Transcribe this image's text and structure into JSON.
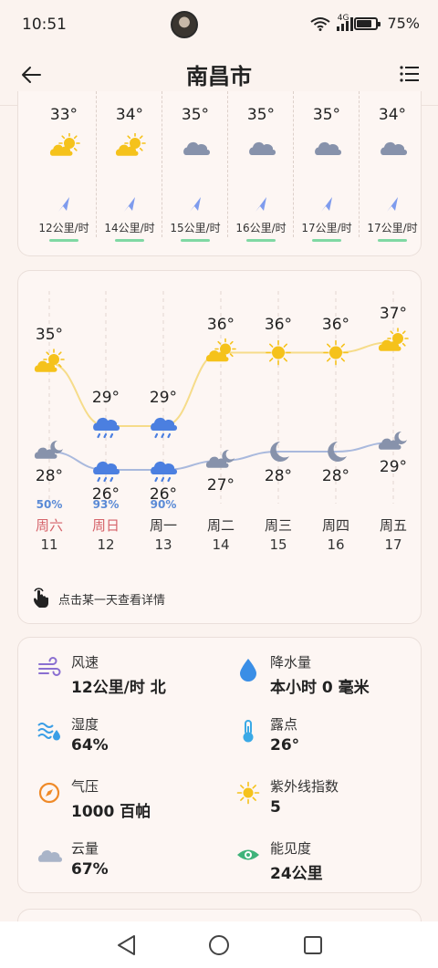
{
  "status_bar": {
    "time": "10:51",
    "network": "4G",
    "battery": "75%"
  },
  "header": {
    "title": "南昌市"
  },
  "hourly": [
    {
      "temp": "33°",
      "icon": "sunny-cloudy",
      "wind": "12公里/时"
    },
    {
      "temp": "34°",
      "icon": "sunny-cloudy",
      "wind": "14公里/时"
    },
    {
      "temp": "35°",
      "icon": "cloudy",
      "wind": "15公里/时"
    },
    {
      "temp": "35°",
      "icon": "cloudy",
      "wind": "16公里/时"
    },
    {
      "temp": "35°",
      "icon": "cloudy",
      "wind": "17公里/时"
    },
    {
      "temp": "34°",
      "icon": "cloudy",
      "wind": "17公里/时"
    }
  ],
  "daily": [
    {
      "weekday": "周六",
      "date": "11",
      "high": 35,
      "high_label": "35°",
      "low": 28,
      "low_label": "28°",
      "pop": "50%",
      "day_icon": "sunny-cloudy",
      "night_icon": "cloudy-night",
      "weekend": true
    },
    {
      "weekday": "周日",
      "date": "12",
      "high": 29,
      "high_label": "29°",
      "low": 26,
      "low_label": "26°",
      "pop": "93%",
      "day_icon": "rain",
      "night_icon": "rain",
      "weekend": true
    },
    {
      "weekday": "周一",
      "date": "13",
      "high": 29,
      "high_label": "29°",
      "low": 26,
      "low_label": "26°",
      "pop": "90%",
      "day_icon": "rain",
      "night_icon": "rain",
      "weekend": false
    },
    {
      "weekday": "周二",
      "date": "14",
      "high": 36,
      "high_label": "36°",
      "low": 27,
      "low_label": "27°",
      "pop": "",
      "day_icon": "sunny-cloudy",
      "night_icon": "cloudy-night",
      "weekend": false
    },
    {
      "weekday": "周三",
      "date": "15",
      "high": 36,
      "high_label": "36°",
      "low": 28,
      "low_label": "28°",
      "pop": "",
      "day_icon": "sunny",
      "night_icon": "moon",
      "weekend": false
    },
    {
      "weekday": "周四",
      "date": "16",
      "high": 36,
      "high_label": "36°",
      "low": 28,
      "low_label": "28°",
      "pop": "",
      "day_icon": "sunny",
      "night_icon": "moon",
      "weekend": false
    },
    {
      "weekday": "周五",
      "date": "17",
      "high": 37,
      "high_label": "37°",
      "low": 29,
      "low_label": "29°",
      "pop": "",
      "day_icon": "sunny-cloudy",
      "night_icon": "cloudy-night",
      "weekend": false
    }
  ],
  "daily_hint": "点击某一天查看详情",
  "details": [
    {
      "label": "风速",
      "value": "12公里/时 北",
      "icon": "wind-icon",
      "color": "#8a6fd1"
    },
    {
      "label": "降水量",
      "value": "本小时 0 毫米",
      "icon": "raindrop-icon",
      "color": "#3a8ee6"
    },
    {
      "label": "湿度",
      "value": "64%",
      "icon": "humidity-icon",
      "color": "#3a9ee6"
    },
    {
      "label": "露点",
      "value": "26°",
      "icon": "thermometer-icon",
      "color": "#3aa9e6"
    },
    {
      "label": "气压",
      "value": "1000 百帕",
      "icon": "compass-icon",
      "color": "#ef8a28"
    },
    {
      "label": "紫外线指数",
      "value": "5",
      "icon": "sun-icon",
      "color": "#f5c21b"
    },
    {
      "label": "云量",
      "value": "67%",
      "icon": "cloud-icon",
      "color": "#a9b4c8"
    },
    {
      "label": "能见度",
      "value": "24公里",
      "icon": "eye-icon",
      "color": "#3fb37a"
    }
  ],
  "colors": {
    "sun": "#f5c21b",
    "cloud": "#8792ab",
    "rain": "#4b7fe0",
    "high_line": "#f6dc8a",
    "low_line": "#a9b9dd",
    "wind": "#7e9bed"
  }
}
